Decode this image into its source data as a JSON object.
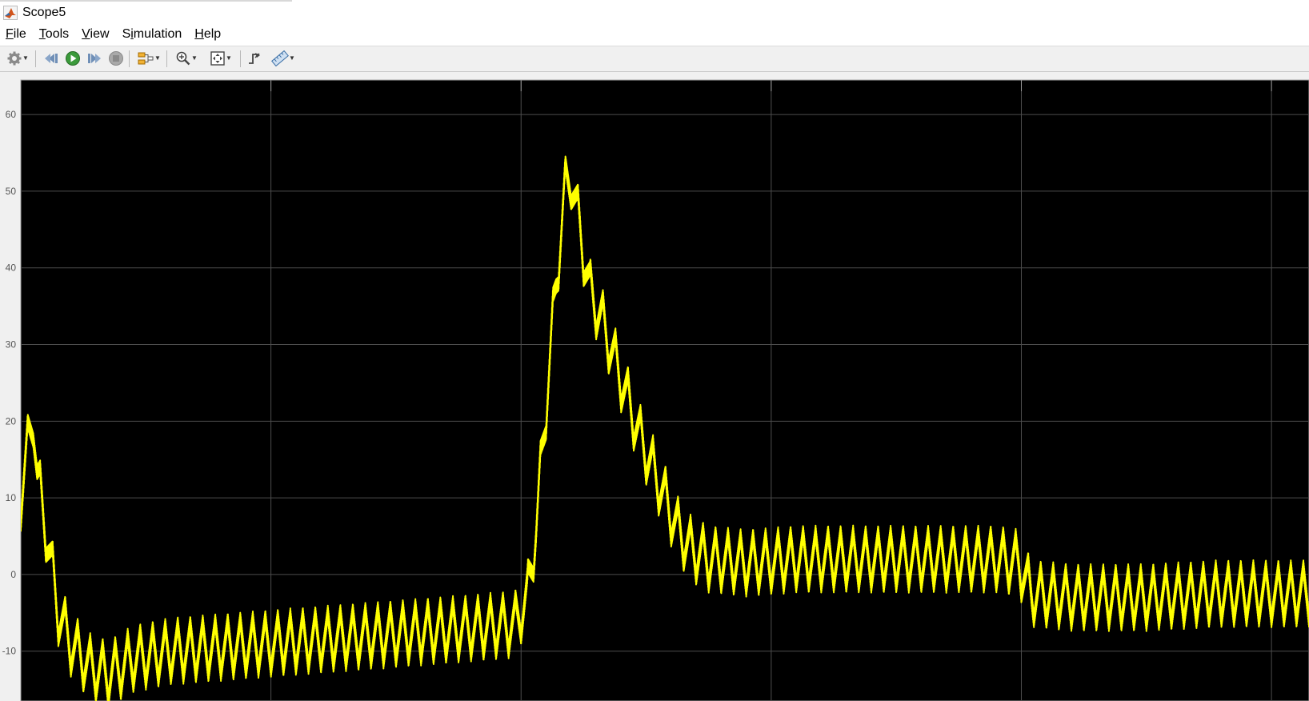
{
  "window": {
    "title": "Scope5"
  },
  "menu": {
    "items": [
      {
        "pre": "",
        "ul": "F",
        "post": "ile"
      },
      {
        "pre": "",
        "ul": "T",
        "post": "ools"
      },
      {
        "pre": "",
        "ul": "V",
        "post": "iew"
      },
      {
        "pre": "S",
        "ul": "i",
        "post": "mulation"
      },
      {
        "pre": "",
        "ul": "H",
        "post": "elp"
      }
    ]
  },
  "toolbar": {
    "icons": [
      "gear-icon",
      "step-back-icon",
      "run-icon",
      "step-forward-icon",
      "stop-icon",
      "highlight-block-icon",
      "zoom-in-icon",
      "autoscale-icon",
      "triggers-icon",
      "cursor-measurements-icon"
    ]
  },
  "colors": {
    "signal": "#ffff00",
    "plot_background": "#000000",
    "grid": "#4d4d4d",
    "axis_text": "#bfbfbf"
  },
  "chart_data": {
    "type": "line",
    "title": "",
    "xlabel": "",
    "ylabel": "",
    "ylim": [
      -16.5,
      64.5
    ],
    "xlim": [
      0,
      1.03
    ],
    "x_ticks": [
      0,
      0.2,
      0.4,
      0.6,
      0.8,
      1.0
    ],
    "y_ticks": [
      60,
      50,
      40,
      30,
      20,
      10,
      0,
      -10
    ],
    "y_tick_labels": [
      "60",
      "50",
      "40",
      "30",
      "20",
      "10",
      "0",
      "-10"
    ],
    "grid": true,
    "legend": "none",
    "series": [
      {
        "style": "ripple",
        "ripple_peak_to_peak": 7,
        "envelope": [
          [
            0.0,
            10
          ],
          [
            0.005,
            16
          ],
          [
            0.01,
            21
          ],
          [
            0.013,
            13
          ],
          [
            0.02,
            6
          ],
          [
            0.03,
            -5
          ],
          [
            0.04,
            -9
          ],
          [
            0.055,
            -12
          ],
          [
            0.07,
            -13
          ],
          [
            0.09,
            -11
          ],
          [
            0.12,
            -10
          ],
          [
            0.16,
            -9.5
          ],
          [
            0.2,
            -9
          ],
          [
            0.24,
            -8.5
          ],
          [
            0.28,
            -8
          ],
          [
            0.32,
            -7.5
          ],
          [
            0.36,
            -7
          ],
          [
            0.395,
            -6.5
          ],
          [
            0.405,
            -3
          ],
          [
            0.412,
            6
          ],
          [
            0.42,
            22
          ],
          [
            0.428,
            38
          ],
          [
            0.435,
            50
          ],
          [
            0.44,
            52
          ],
          [
            0.447,
            45
          ],
          [
            0.455,
            37
          ],
          [
            0.465,
            33
          ],
          [
            0.475,
            28
          ],
          [
            0.485,
            23
          ],
          [
            0.495,
            18
          ],
          [
            0.505,
            14
          ],
          [
            0.515,
            10
          ],
          [
            0.525,
            6
          ],
          [
            0.535,
            3.5
          ],
          [
            0.55,
            2
          ],
          [
            0.58,
            1.5
          ],
          [
            0.62,
            2
          ],
          [
            0.66,
            2
          ],
          [
            0.7,
            2
          ],
          [
            0.74,
            2
          ],
          [
            0.78,
            2
          ],
          [
            0.798,
            1.5
          ],
          [
            0.808,
            -2.5
          ],
          [
            0.84,
            -3
          ],
          [
            0.9,
            -3
          ],
          [
            0.96,
            -2.5
          ],
          [
            1.03,
            -2.5
          ]
        ]
      }
    ]
  }
}
